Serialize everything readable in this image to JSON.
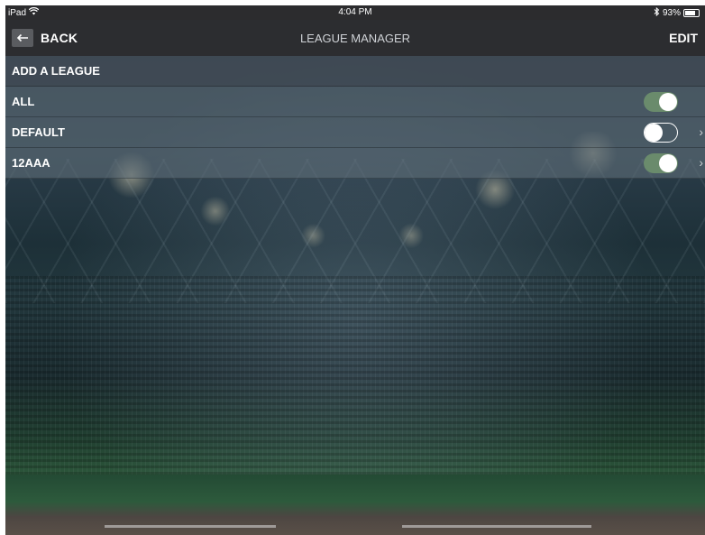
{
  "status": {
    "device": "iPad",
    "time": "4:04 PM",
    "battery_text": "93%",
    "battery_level": 0.93
  },
  "nav": {
    "back_label": "BACK",
    "title": "LEAGUE MANAGER",
    "edit_label": "EDIT"
  },
  "list": {
    "add_label": "ADD A LEAGUE",
    "leagues": [
      {
        "name": "ALL",
        "enabled": true,
        "has_chevron": false
      },
      {
        "name": "DEFAULT",
        "enabled": false,
        "has_chevron": true
      },
      {
        "name": "12AAA",
        "enabled": true,
        "has_chevron": true
      }
    ]
  },
  "colors": {
    "nav_background": "#2c2d30",
    "toggle_on": "#6a8b6c",
    "text": "#ffffff"
  },
  "icons": {
    "wifi": "wifi-icon",
    "bluetooth": "bluetooth-icon",
    "battery": "battery-icon",
    "back": "arrow-left-icon",
    "chevron": "chevron-right-icon"
  }
}
